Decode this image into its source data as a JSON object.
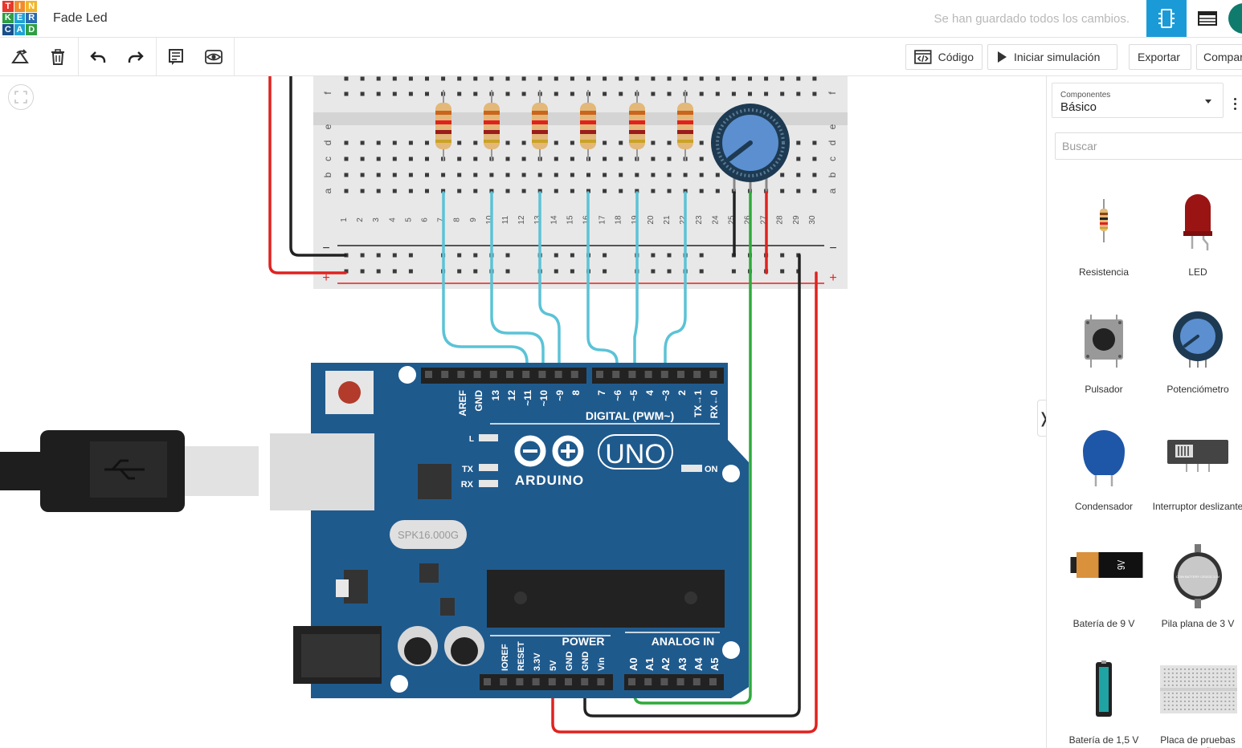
{
  "app": {
    "logo_letters": [
      "T",
      "I",
      "N",
      "K",
      "E",
      "R",
      "C",
      "A",
      "D"
    ],
    "logo_colors": [
      "#e8372c",
      "#f28b2a",
      "#f2b52a",
      "#2f9e44",
      "#1fa3d6",
      "#2b6cb0",
      "#1a4f8b",
      "#1fa3d6",
      "#2f9e44"
    ],
    "project_title": "Fade Led",
    "save_status": "Se han guardado todos los cambios.",
    "accent": "#1a9bd7"
  },
  "toolbar": {
    "code_label": "Código",
    "simulate_label": "Iniciar simulación",
    "export_label": "Exportar",
    "share_label": "Compartir"
  },
  "panel": {
    "components_label": "Componentes",
    "components_value": "Básico",
    "search_placeholder": "Buscar",
    "items": [
      {
        "label": "Resistencia",
        "icon": "resistor-icon"
      },
      {
        "label": "LED",
        "icon": "led-icon"
      },
      {
        "label": "Pulsador",
        "icon": "pushbutton-icon"
      },
      {
        "label": "Potenciómetro",
        "icon": "potentiometer-icon"
      },
      {
        "label": "Condensador",
        "icon": "capacitor-icon"
      },
      {
        "label": "Interruptor deslizante",
        "icon": "slide-switch-icon"
      },
      {
        "label": "Batería de 9 V",
        "icon": "battery-9v-icon"
      },
      {
        "label": "Pila plana de 3 V",
        "icon": "coin-battery-icon"
      },
      {
        "label": "Batería de 1,5 V",
        "icon": "battery-aa-icon"
      },
      {
        "label": "Placa de pruebas pequeña",
        "icon": "breadboard-small-icon"
      }
    ],
    "battery_9v_text": "9V",
    "coin_battery_text": "COIN BATTERY CR2032 3.0V"
  },
  "breadboard": {
    "row_letters_top": [
      "f"
    ],
    "row_letters": [
      "e",
      "d",
      "c",
      "b",
      "a"
    ],
    "column_numbers": [
      "1",
      "2",
      "3",
      "4",
      "5",
      "6",
      "7",
      "8",
      "9",
      "10",
      "11",
      "12",
      "13",
      "14",
      "15",
      "16",
      "17",
      "18",
      "19",
      "20",
      "21",
      "22",
      "23",
      "24",
      "25",
      "26",
      "27",
      "28",
      "29",
      "30"
    ],
    "minus": "−",
    "plus": "+"
  },
  "arduino": {
    "digital_pins": [
      "AREF",
      "GND",
      "13",
      "12",
      "~11",
      "~10",
      "~9",
      "8",
      "7",
      "~6",
      "~5",
      "4",
      "~3",
      "2",
      "TX→1",
      "RX←0"
    ],
    "digital_label": "DIGITAL (PWM~)",
    "brand": "ARDUINO",
    "model": "UNO",
    "led_labels": [
      "L",
      "TX",
      "RX"
    ],
    "on_label": "ON",
    "crystal_text": "SPK16.000G",
    "power_label": "POWER",
    "analog_label": "ANALOG IN",
    "power_pins": [
      "IOREF",
      "RESET",
      "3.3V",
      "5V",
      "GND",
      "GND",
      "Vin"
    ],
    "analog_pins": [
      "A0",
      "A1",
      "A2",
      "A3",
      "A4",
      "A5"
    ]
  },
  "colors": {
    "board_blue": "#1f5a8d",
    "wire_cyan": "#5bc3d6",
    "wire_red": "#e0221f",
    "wire_black": "#222222",
    "wire_green": "#2eaa3c"
  }
}
